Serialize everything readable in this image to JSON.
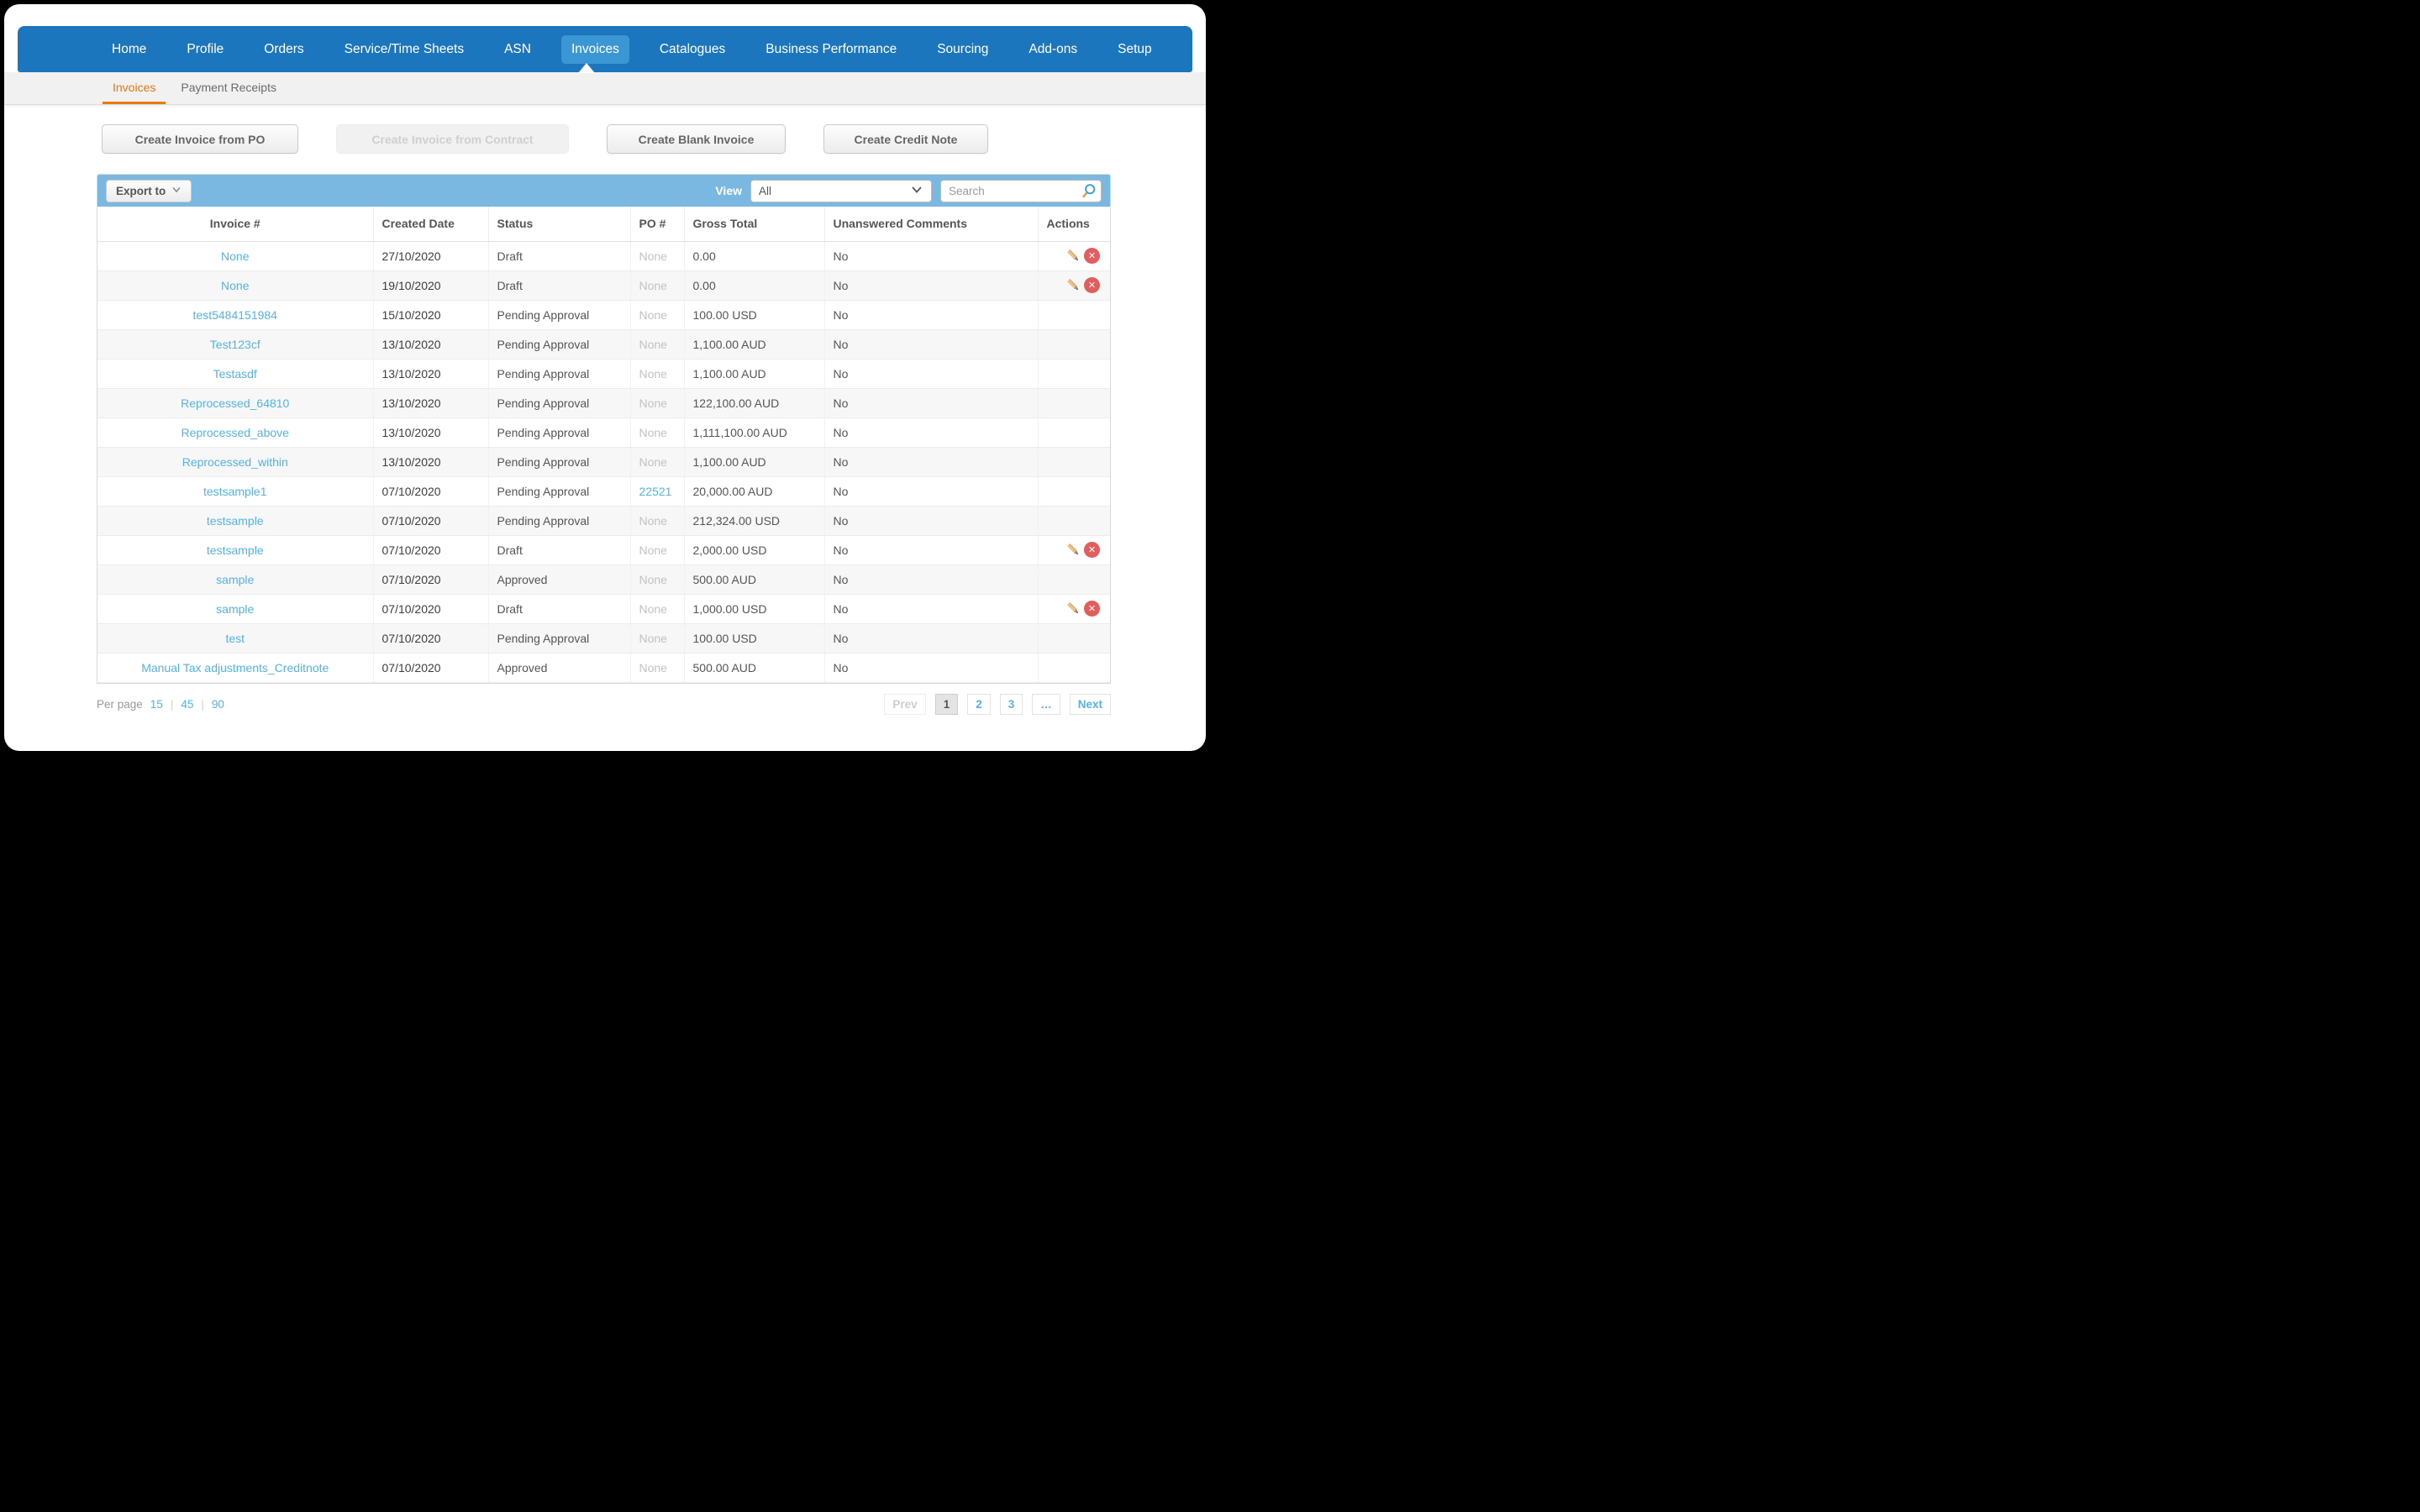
{
  "nav": {
    "items": [
      {
        "label": "Home"
      },
      {
        "label": "Profile"
      },
      {
        "label": "Orders"
      },
      {
        "label": "Service/Time Sheets"
      },
      {
        "label": "ASN"
      },
      {
        "label": "Invoices",
        "active": true
      },
      {
        "label": "Catalogues"
      },
      {
        "label": "Business Performance"
      },
      {
        "label": "Sourcing"
      },
      {
        "label": "Add-ons"
      },
      {
        "label": "Setup"
      }
    ]
  },
  "subnav": {
    "tabs": [
      {
        "label": "Invoices",
        "active": true
      },
      {
        "label": "Payment Receipts",
        "active": false
      }
    ]
  },
  "create_buttons": [
    {
      "label": "Create Invoice from PO",
      "enabled": true
    },
    {
      "label": "Create Invoice from Contract",
      "enabled": false
    },
    {
      "label": "Create Blank Invoice",
      "enabled": true
    },
    {
      "label": "Create Credit Note",
      "enabled": true
    }
  ],
  "toolbar": {
    "export_label": "Export to",
    "view_label": "View",
    "view_value": "All",
    "search_placeholder": "Search"
  },
  "table": {
    "columns": [
      "Invoice #",
      "Created Date",
      "Status",
      "PO #",
      "Gross Total",
      "Unanswered Comments",
      "Actions"
    ],
    "rows": [
      {
        "invoice": "None",
        "created": "27/10/2020",
        "status": "Draft",
        "po": "None",
        "po_is_link": false,
        "gross": "0.00",
        "comments": "No",
        "has_actions": true,
        "highlighted": true
      },
      {
        "invoice": "None",
        "created": "19/10/2020",
        "status": "Draft",
        "po": "None",
        "po_is_link": false,
        "gross": "0.00",
        "comments": "No",
        "has_actions": true,
        "highlighted": false
      },
      {
        "invoice": "test5484151984",
        "created": "15/10/2020",
        "status": "Pending Approval",
        "po": "None",
        "po_is_link": false,
        "gross": "100.00 USD",
        "comments": "No",
        "has_actions": false,
        "highlighted": false
      },
      {
        "invoice": "Test123cf",
        "created": "13/10/2020",
        "status": "Pending Approval",
        "po": "None",
        "po_is_link": false,
        "gross": "1,100.00 AUD",
        "comments": "No",
        "has_actions": false,
        "highlighted": false
      },
      {
        "invoice": "Testasdf",
        "created": "13/10/2020",
        "status": "Pending Approval",
        "po": "None",
        "po_is_link": false,
        "gross": "1,100.00 AUD",
        "comments": "No",
        "has_actions": false,
        "highlighted": false
      },
      {
        "invoice": "Reprocessed_64810",
        "created": "13/10/2020",
        "status": "Pending Approval",
        "po": "None",
        "po_is_link": false,
        "gross": "122,100.00 AUD",
        "comments": "No",
        "has_actions": false,
        "highlighted": false
      },
      {
        "invoice": "Reprocessed_above",
        "created": "13/10/2020",
        "status": "Pending Approval",
        "po": "None",
        "po_is_link": false,
        "gross": "1,111,100.00 AUD",
        "comments": "No",
        "has_actions": false,
        "highlighted": false
      },
      {
        "invoice": "Reprocessed_within",
        "created": "13/10/2020",
        "status": "Pending Approval",
        "po": "None",
        "po_is_link": false,
        "gross": "1,100.00 AUD",
        "comments": "No",
        "has_actions": false,
        "highlighted": false
      },
      {
        "invoice": "testsample1",
        "created": "07/10/2020",
        "status": "Pending Approval",
        "po": "22521",
        "po_is_link": true,
        "gross": "20,000.00 AUD",
        "comments": "No",
        "has_actions": false,
        "highlighted": false
      },
      {
        "invoice": "testsample",
        "created": "07/10/2020",
        "status": "Pending Approval",
        "po": "None",
        "po_is_link": false,
        "gross": "212,324.00 USD",
        "comments": "No",
        "has_actions": false,
        "highlighted": false
      },
      {
        "invoice": "testsample",
        "created": "07/10/2020",
        "status": "Draft",
        "po": "None",
        "po_is_link": false,
        "gross": "2,000.00 USD",
        "comments": "No",
        "has_actions": true,
        "highlighted": false
      },
      {
        "invoice": "sample",
        "created": "07/10/2020",
        "status": "Approved",
        "po": "None",
        "po_is_link": false,
        "gross": "500.00 AUD",
        "comments": "No",
        "has_actions": false,
        "highlighted": false
      },
      {
        "invoice": "sample",
        "created": "07/10/2020",
        "status": "Draft",
        "po": "None",
        "po_is_link": false,
        "gross": "1,000.00 USD",
        "comments": "No",
        "has_actions": true,
        "highlighted": false
      },
      {
        "invoice": "test",
        "created": "07/10/2020",
        "status": "Pending Approval",
        "po": "None",
        "po_is_link": false,
        "gross": "100.00 USD",
        "comments": "No",
        "has_actions": false,
        "highlighted": false
      },
      {
        "invoice": "Manual Tax adjustments_Creditnote",
        "created": "07/10/2020",
        "status": "Approved",
        "po": "None",
        "po_is_link": false,
        "gross": "500.00 AUD",
        "comments": "No",
        "has_actions": false,
        "highlighted": false
      }
    ]
  },
  "footer": {
    "per_page_label": "Per page",
    "per_page_options": [
      "15",
      "45",
      "90"
    ],
    "pagination": [
      {
        "label": "Prev",
        "state": "disabled"
      },
      {
        "label": "1",
        "state": "current"
      },
      {
        "label": "2",
        "state": "page"
      },
      {
        "label": "3",
        "state": "page"
      },
      {
        "label": "…",
        "state": "page"
      },
      {
        "label": "Next",
        "state": "page"
      }
    ]
  },
  "icons": {
    "export_chevron": "chevron-down",
    "view_chevron": "chevron-down",
    "search": "magnifier",
    "edit": "pencil",
    "delete": "circle-x"
  },
  "colors": {
    "nav_blue": "#1b76bd",
    "active_nav_pill": "#3b97d3",
    "toolbar_blue": "#7ab8e1",
    "link_blue": "#54b2e4",
    "accent_orange": "#e4760f",
    "delete_red": "#e15d5e",
    "pencil_tan": "#edc28a",
    "row_alt_gray": "#f7f7f7",
    "row_accent_blue": "#72b0da"
  }
}
